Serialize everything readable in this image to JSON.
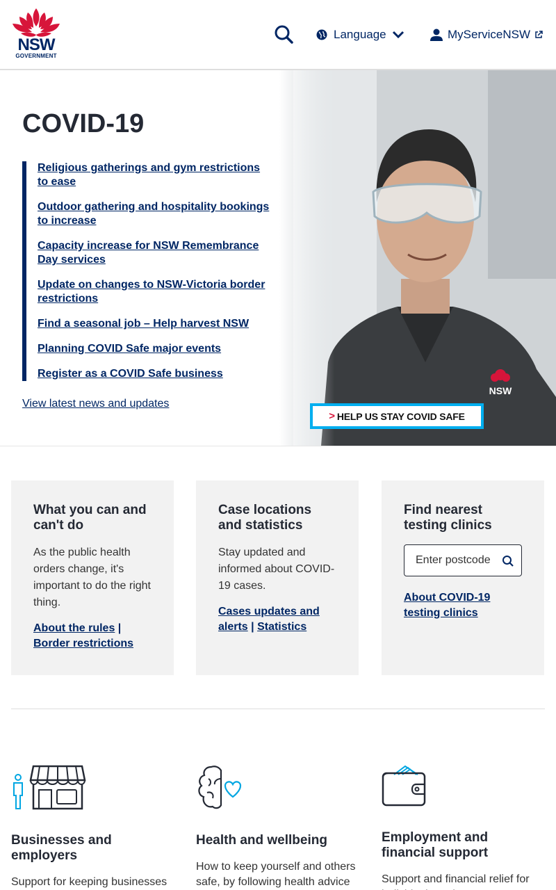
{
  "header": {
    "logo_text": "NSW",
    "logo_subtext": "GOVERNMENT",
    "search_icon": "search-icon",
    "language_label": "Language",
    "myservice_label": "MyServiceNSW"
  },
  "hero": {
    "title": "COVID-19",
    "news": [
      "Religious gatherings and gym restrictions to ease",
      "Outdoor gathering and hospitality bookings to increase",
      "Capacity increase for NSW Remembrance Day services",
      "Update on changes to NSW-Victoria border restrictions",
      "Find a seasonal job – Help harvest NSW",
      "Planning COVID Safe major events",
      "Register as a COVID Safe business"
    ],
    "view_latest": "View latest news and updates",
    "banner_text": "HELP US STAY COVID SAFE",
    "image_alt": "Doctor in scrubs and safety glasses"
  },
  "cards": [
    {
      "title": "What you can and can't do",
      "body": "As the public health orders change, it's important to do the right thing.",
      "link1": "About the rules",
      "link2": "Border restrictions"
    },
    {
      "title": "Case locations and statistics",
      "body": "Stay updated and informed about COVID-19 cases.",
      "link1": "Cases updates and alerts",
      "link2": "Statistics"
    },
    {
      "title": "Find nearest testing clinics",
      "postcode_placeholder": "Enter postcode",
      "link1": "About COVID-19 testing clinics"
    }
  ],
  "topics": [
    {
      "title": "Businesses and employers",
      "body": "Support for keeping businesses open and",
      "icon": "shopfront-icon"
    },
    {
      "title": "Health and wellbeing",
      "body": "How to keep yourself and others safe, by following health advice",
      "icon": "brain-heart-icon"
    },
    {
      "title": "Employment and financial support",
      "body": "Support and financial relief for individuals and",
      "icon": "wallet-icon"
    }
  ],
  "colors": {
    "navy": "#002664",
    "red": "#d7153a",
    "card_bg": "#f2f2f2",
    "accent_blue": "#00aeef",
    "light_blue": "#00a6e2"
  }
}
